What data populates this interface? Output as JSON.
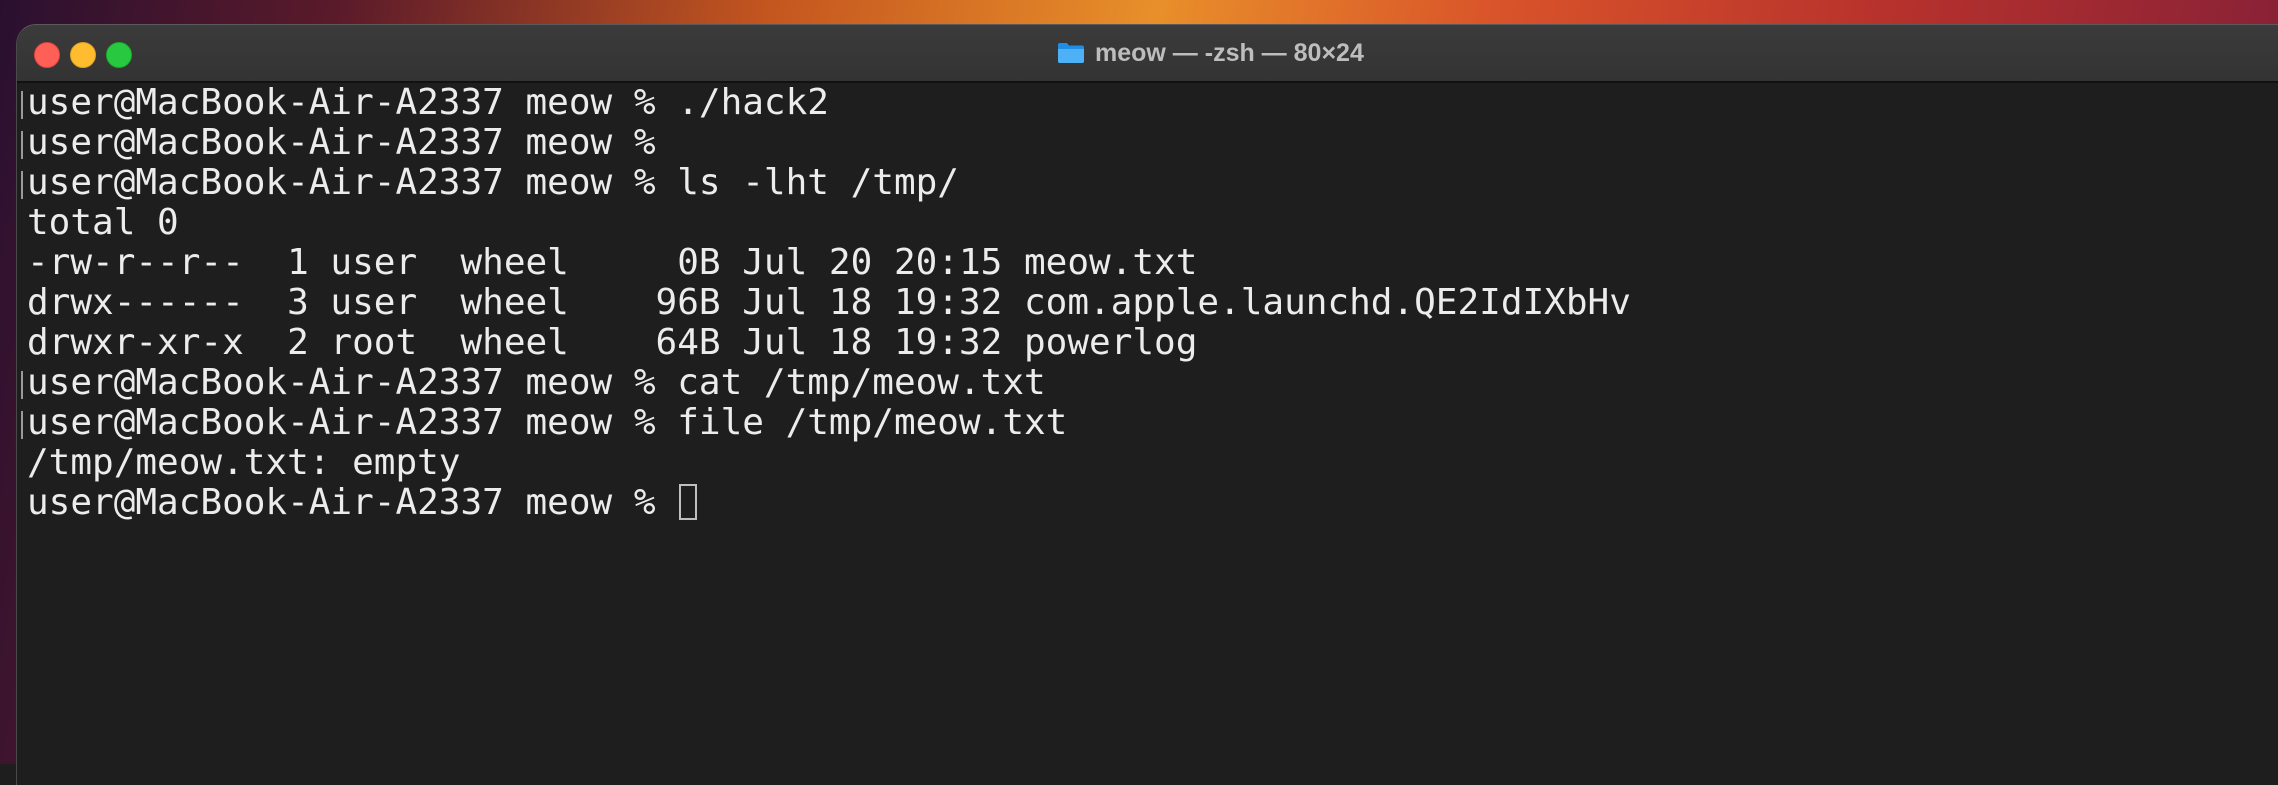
{
  "window": {
    "title": "meow — -zsh — 80×24"
  },
  "terminal": {
    "lines": [
      {
        "text": "user@MacBook-Air-A2337 meow % ./hack2",
        "mark": true
      },
      {
        "text": "user@MacBook-Air-A2337 meow % ",
        "mark": true
      },
      {
        "text": "user@MacBook-Air-A2337 meow % ls -lht /tmp/",
        "mark": true
      },
      {
        "text": "total 0",
        "mark": false
      },
      {
        "text": "-rw-r--r--  1 user  wheel     0B Jul 20 20:15 meow.txt",
        "mark": false
      },
      {
        "text": "drwx------  3 user  wheel    96B Jul 18 19:32 com.apple.launchd.QE2IdIXbHv",
        "mark": false
      },
      {
        "text": "drwxr-xr-x  2 root  wheel    64B Jul 18 19:32 powerlog",
        "mark": false
      },
      {
        "text": "user@MacBook-Air-A2337 meow % cat /tmp/meow.txt",
        "mark": true
      },
      {
        "text": "user@MacBook-Air-A2337 meow % file /tmp/meow.txt",
        "mark": true
      },
      {
        "text": "/tmp/meow.txt: empty",
        "mark": false
      },
      {
        "text": "user@MacBook-Air-A2337 meow % ",
        "mark": false,
        "cursor": true
      }
    ]
  },
  "colors": {
    "close": "#fe5f57",
    "minimize": "#febc2e",
    "zoom": "#28c840",
    "background": "#1e1e1e",
    "text": "#ececec"
  },
  "icons": {
    "title": "folder-icon"
  }
}
